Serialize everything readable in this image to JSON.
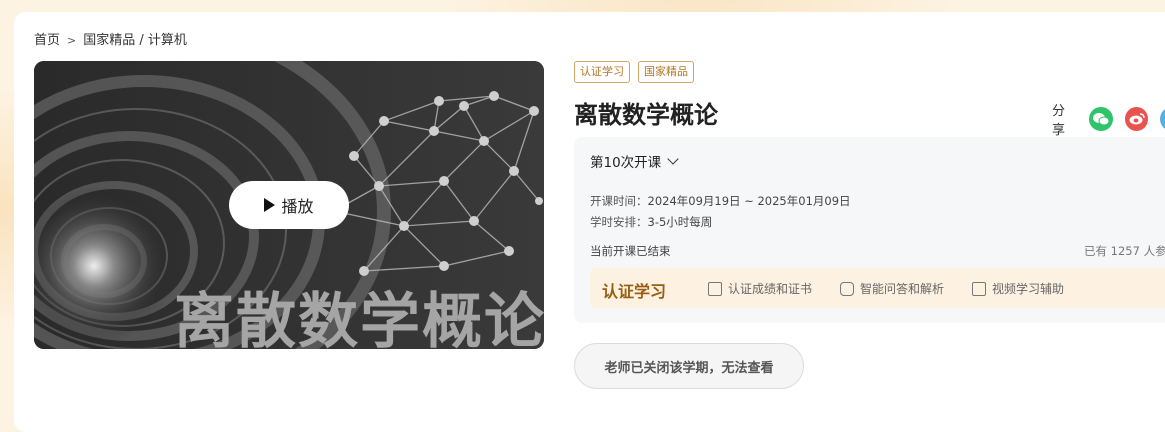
{
  "breadcrumb": {
    "home": "首页",
    "separator": ">",
    "path": "国家精品 / 计算机"
  },
  "cover": {
    "title": "离散数学概论",
    "play_label": "播放"
  },
  "tags": [
    "认证学习",
    "国家精品"
  ],
  "course_title": "离散数学概论",
  "share": {
    "label": "分享",
    "icons": [
      "wechat-icon",
      "weibo-icon",
      "qq-icon"
    ]
  },
  "term": {
    "label": "第10次开课",
    "time_label": "开课时间：",
    "time_value": "2024年09月19日 ~ 2025年01月09日",
    "schedule_label": "学时安排：",
    "schedule_value": "3-5小时每周",
    "status": "当前开课已结束",
    "enrolled": "已有 1257 人参"
  },
  "certification": {
    "title": "认证学习",
    "features": [
      "认证成绩和证书",
      "智能问答和解析",
      "视频学习辅助"
    ]
  },
  "closed_button": "老师已关闭该学期，无法查看",
  "colors": {
    "accent": "#b4762a",
    "cert_title": "#9a5e12",
    "wechat": "#2ec56a",
    "weibo": "#e9524f",
    "qq": "#5aaee6"
  }
}
